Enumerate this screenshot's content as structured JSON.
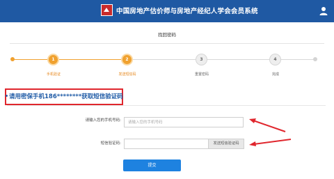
{
  "header": {
    "title": "中国房地产估价师与房地产经纪人学会会员系统",
    "brand_color": "#1f59a3",
    "logo_icon": "house-logo-icon",
    "user_icon": "user-icon"
  },
  "page": {
    "title": "找回密码"
  },
  "steps": [
    {
      "number": "1",
      "label": "手机验证",
      "state": "active"
    },
    {
      "number": "2",
      "label": "发送短信码",
      "state": "active"
    },
    {
      "number": "3",
      "label": "重置密码",
      "state": "inactive"
    },
    {
      "number": "4",
      "label": "完成",
      "state": "inactive"
    }
  ],
  "notice": {
    "text": "请用密保手机186********获取短信验证码"
  },
  "form": {
    "phone_label": "请输入您的手机号码:",
    "phone_placeholder": "请输入您的手机号码",
    "sms_label": "短信验证码:",
    "sms_placeholder": "",
    "sms_button": "发送短信验证码",
    "submit": "提交"
  },
  "colors": {
    "accent_orange": "#f0a12f",
    "notice_blue": "#1f5ba6",
    "highlight_red": "#e0262d",
    "submit_blue": "#1e82e0"
  }
}
